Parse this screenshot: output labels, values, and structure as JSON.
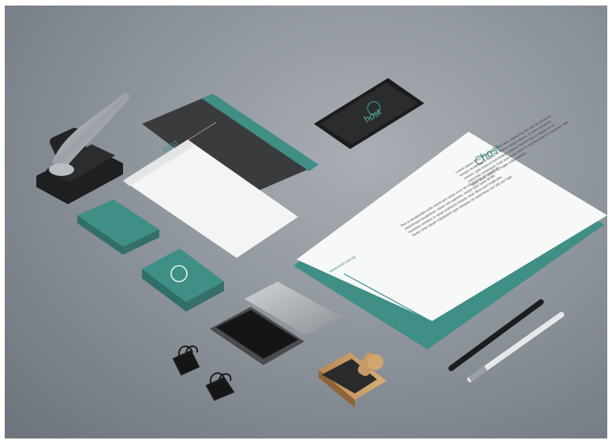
{
  "brand": {
    "name": "host",
    "accent_color": "#3f8f86",
    "dark_color": "#2e2f31"
  },
  "letterhead": {
    "paragraph_1": "Lorem ipsum dolor sit amet, consectetur adipiscing elit, sed do eiusmod tempor incididunt ut labore et dolore magna aliqua. Ut enim ad minim veniam, quis nostrud exercitation ullamco laboris nisi ut aliquip ex ea commodo consequat. Duis aute irure dolor in reprehenderit in voluptate velit esse cillum dolore eu fugiat nulla pariatur.",
    "paragraph_2": "Sed ut perspiciatis unde omnis iste natus error sit voluptatem accusantium doloremque laudantium, totam rem aperiam, eaque ipsa quae ab illo inventore veritatis et quasi architecto beatae vitae dicta sunt explicabo. Nemo enim ipsam voluptatem quia voluptas sit aspernatur aut odit aut fugit.",
    "url": "www.host.com.br"
  },
  "scene": {
    "objects": [
      "embosser-icon",
      "envelope",
      "folded-letter",
      "smartphone",
      "letterhead",
      "business-cards",
      "ink-pad",
      "binder-clips",
      "rubber-stamp",
      "pens"
    ]
  }
}
